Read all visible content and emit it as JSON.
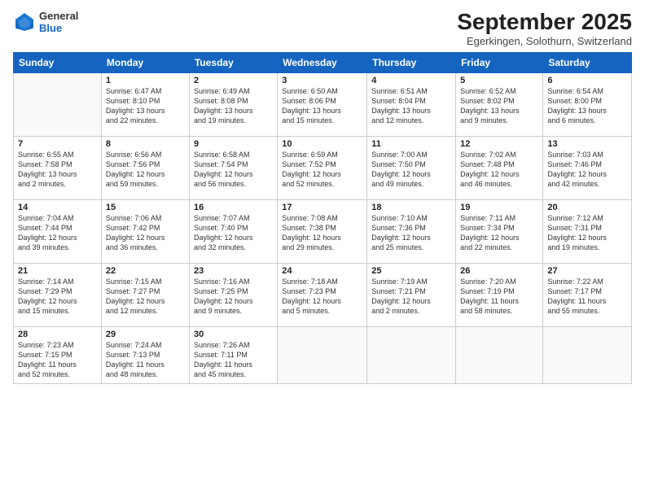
{
  "logo": {
    "general": "General",
    "blue": "Blue"
  },
  "header": {
    "month": "September 2025",
    "location": "Egerkingen, Solothurn, Switzerland"
  },
  "days": [
    "Sunday",
    "Monday",
    "Tuesday",
    "Wednesday",
    "Thursday",
    "Friday",
    "Saturday"
  ],
  "weeks": [
    [
      {
        "num": "",
        "text": ""
      },
      {
        "num": "1",
        "text": "Sunrise: 6:47 AM\nSunset: 8:10 PM\nDaylight: 13 hours\nand 22 minutes."
      },
      {
        "num": "2",
        "text": "Sunrise: 6:49 AM\nSunset: 8:08 PM\nDaylight: 13 hours\nand 19 minutes."
      },
      {
        "num": "3",
        "text": "Sunrise: 6:50 AM\nSunset: 8:06 PM\nDaylight: 13 hours\nand 15 minutes."
      },
      {
        "num": "4",
        "text": "Sunrise: 6:51 AM\nSunset: 8:04 PM\nDaylight: 13 hours\nand 12 minutes."
      },
      {
        "num": "5",
        "text": "Sunrise: 6:52 AM\nSunset: 8:02 PM\nDaylight: 13 hours\nand 9 minutes."
      },
      {
        "num": "6",
        "text": "Sunrise: 6:54 AM\nSunset: 8:00 PM\nDaylight: 13 hours\nand 6 minutes."
      }
    ],
    [
      {
        "num": "7",
        "text": "Sunrise: 6:55 AM\nSunset: 7:58 PM\nDaylight: 13 hours\nand 2 minutes."
      },
      {
        "num": "8",
        "text": "Sunrise: 6:56 AM\nSunset: 7:56 PM\nDaylight: 12 hours\nand 59 minutes."
      },
      {
        "num": "9",
        "text": "Sunrise: 6:58 AM\nSunset: 7:54 PM\nDaylight: 12 hours\nand 56 minutes."
      },
      {
        "num": "10",
        "text": "Sunrise: 6:59 AM\nSunset: 7:52 PM\nDaylight: 12 hours\nand 52 minutes."
      },
      {
        "num": "11",
        "text": "Sunrise: 7:00 AM\nSunset: 7:50 PM\nDaylight: 12 hours\nand 49 minutes."
      },
      {
        "num": "12",
        "text": "Sunrise: 7:02 AM\nSunset: 7:48 PM\nDaylight: 12 hours\nand 46 minutes."
      },
      {
        "num": "13",
        "text": "Sunrise: 7:03 AM\nSunset: 7:46 PM\nDaylight: 12 hours\nand 42 minutes."
      }
    ],
    [
      {
        "num": "14",
        "text": "Sunrise: 7:04 AM\nSunset: 7:44 PM\nDaylight: 12 hours\nand 39 minutes."
      },
      {
        "num": "15",
        "text": "Sunrise: 7:06 AM\nSunset: 7:42 PM\nDaylight: 12 hours\nand 36 minutes."
      },
      {
        "num": "16",
        "text": "Sunrise: 7:07 AM\nSunset: 7:40 PM\nDaylight: 12 hours\nand 32 minutes."
      },
      {
        "num": "17",
        "text": "Sunrise: 7:08 AM\nSunset: 7:38 PM\nDaylight: 12 hours\nand 29 minutes."
      },
      {
        "num": "18",
        "text": "Sunrise: 7:10 AM\nSunset: 7:36 PM\nDaylight: 12 hours\nand 25 minutes."
      },
      {
        "num": "19",
        "text": "Sunrise: 7:11 AM\nSunset: 7:34 PM\nDaylight: 12 hours\nand 22 minutes."
      },
      {
        "num": "20",
        "text": "Sunrise: 7:12 AM\nSunset: 7:31 PM\nDaylight: 12 hours\nand 19 minutes."
      }
    ],
    [
      {
        "num": "21",
        "text": "Sunrise: 7:14 AM\nSunset: 7:29 PM\nDaylight: 12 hours\nand 15 minutes."
      },
      {
        "num": "22",
        "text": "Sunrise: 7:15 AM\nSunset: 7:27 PM\nDaylight: 12 hours\nand 12 minutes."
      },
      {
        "num": "23",
        "text": "Sunrise: 7:16 AM\nSunset: 7:25 PM\nDaylight: 12 hours\nand 9 minutes."
      },
      {
        "num": "24",
        "text": "Sunrise: 7:18 AM\nSunset: 7:23 PM\nDaylight: 12 hours\nand 5 minutes."
      },
      {
        "num": "25",
        "text": "Sunrise: 7:19 AM\nSunset: 7:21 PM\nDaylight: 12 hours\nand 2 minutes."
      },
      {
        "num": "26",
        "text": "Sunrise: 7:20 AM\nSunset: 7:19 PM\nDaylight: 11 hours\nand 58 minutes."
      },
      {
        "num": "27",
        "text": "Sunrise: 7:22 AM\nSunset: 7:17 PM\nDaylight: 11 hours\nand 55 minutes."
      }
    ],
    [
      {
        "num": "28",
        "text": "Sunrise: 7:23 AM\nSunset: 7:15 PM\nDaylight: 11 hours\nand 52 minutes."
      },
      {
        "num": "29",
        "text": "Sunrise: 7:24 AM\nSunset: 7:13 PM\nDaylight: 11 hours\nand 48 minutes."
      },
      {
        "num": "30",
        "text": "Sunrise: 7:26 AM\nSunset: 7:11 PM\nDaylight: 11 hours\nand 45 minutes."
      },
      {
        "num": "",
        "text": ""
      },
      {
        "num": "",
        "text": ""
      },
      {
        "num": "",
        "text": ""
      },
      {
        "num": "",
        "text": ""
      }
    ]
  ]
}
